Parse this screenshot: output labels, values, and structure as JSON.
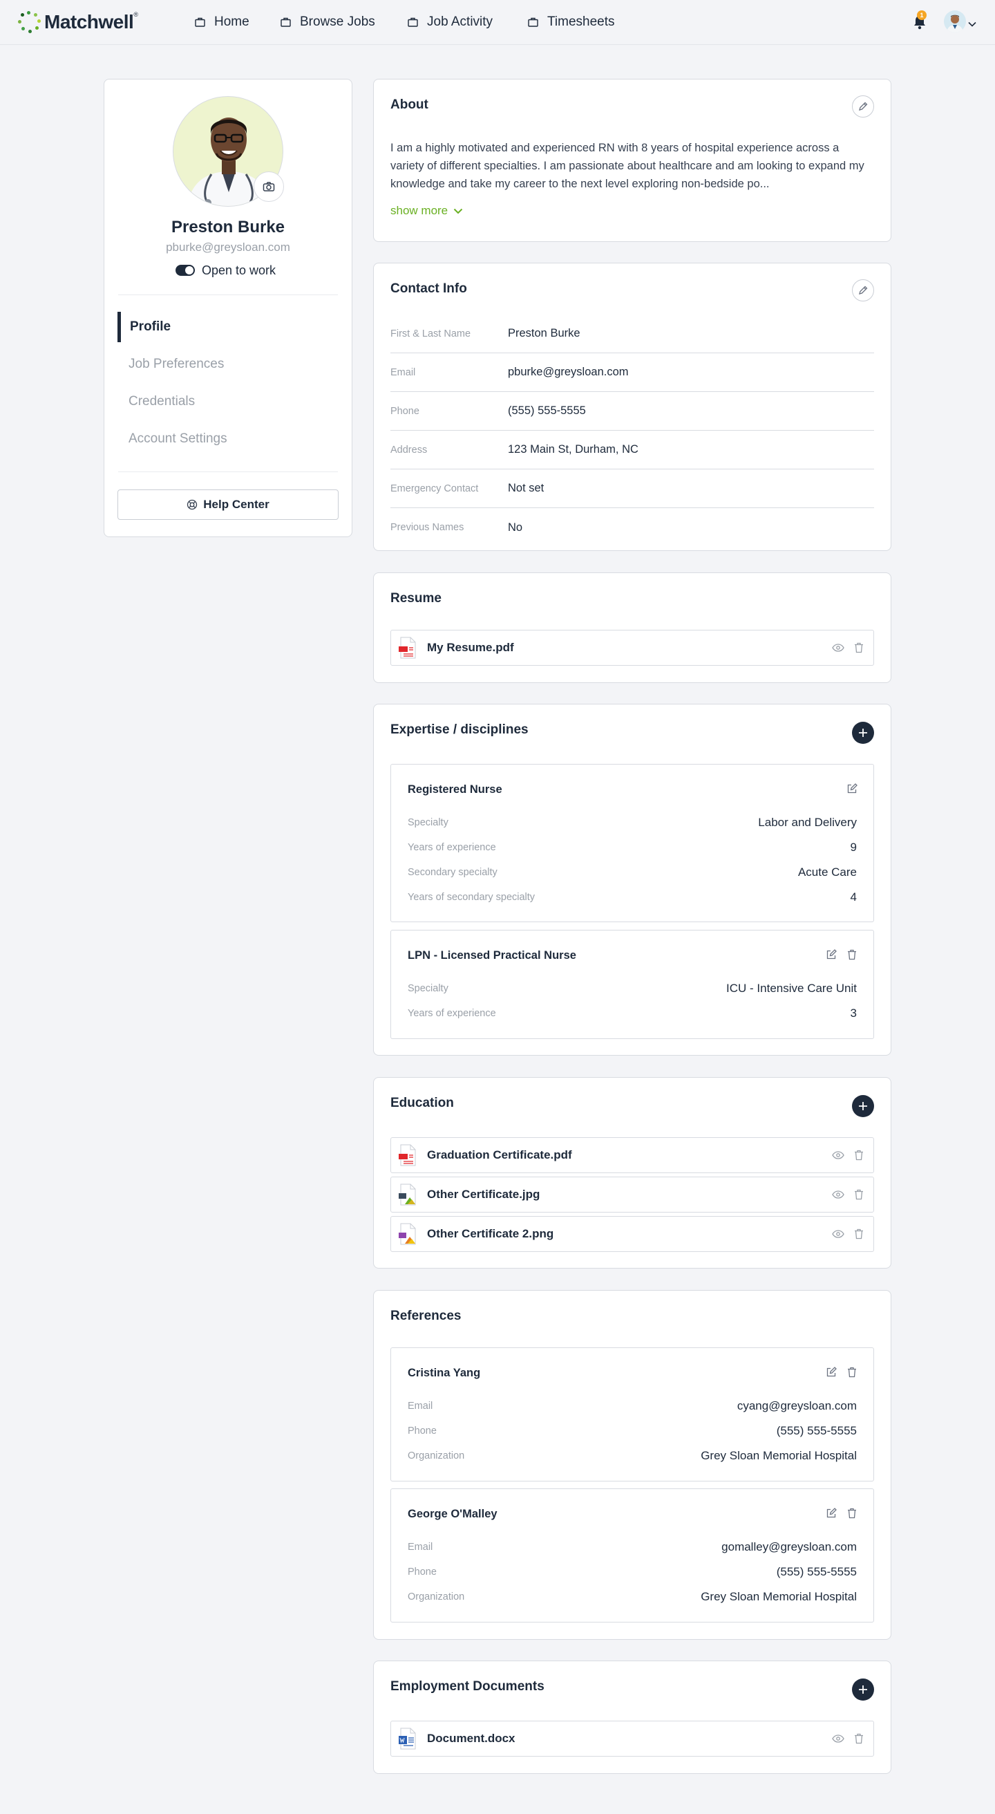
{
  "nav": {
    "brand": "Matchwell",
    "brand_mark": "®",
    "items": [
      {
        "label": "Home"
      },
      {
        "label": "Browse Jobs"
      },
      {
        "label": "Job Activity"
      },
      {
        "label": "Timesheets"
      }
    ],
    "notification_count": "1"
  },
  "profile": {
    "name": "Preston Burke",
    "email": "pburke@greysloan.com",
    "open_to_work_label": "Open to work",
    "menu": [
      {
        "label": "Profile",
        "active": true
      },
      {
        "label": "Job Preferences"
      },
      {
        "label": "Credentials"
      },
      {
        "label": "Account Settings"
      }
    ],
    "help_label": "Help Center"
  },
  "about": {
    "title": "About",
    "text": "I am a highly motivated and experienced RN with 8 years of hospital experience across a variety of different specialties. I am passionate about healthcare and am looking to expand my knowledge and take my career to the next level exploring non-bedside po...",
    "show_more": "show more"
  },
  "contact": {
    "title": "Contact Info",
    "rows": [
      {
        "label": "First & Last Name",
        "value": "Preston Burke"
      },
      {
        "label": "Email",
        "value": "pburke@greysloan.com"
      },
      {
        "label": "Phone",
        "value": "(555) 555-5555"
      },
      {
        "label": "Address",
        "value": "123 Main St, Durham, NC"
      },
      {
        "label": "Emergency Contact",
        "value": "Not set"
      },
      {
        "label": "Previous Names",
        "value": "No"
      }
    ]
  },
  "resume": {
    "title": "Resume",
    "files": [
      {
        "name": "My Resume.pdf",
        "type": "pdf"
      }
    ]
  },
  "expertise": {
    "title": "Expertise / disciplines",
    "items": [
      {
        "title": "Registered Nurse",
        "fields": [
          {
            "k": "Specialty",
            "v": "Labor and Delivery"
          },
          {
            "k": "Years of experience",
            "v": "9"
          },
          {
            "k": "Secondary specialty",
            "v": "Acute Care"
          },
          {
            "k": "Years of secondary specialty",
            "v": "4"
          }
        ]
      },
      {
        "title": "LPN - Licensed Practical Nurse",
        "fields": [
          {
            "k": "Specialty",
            "v": "ICU - Intensive Care Unit"
          },
          {
            "k": "Years of experience",
            "v": "3"
          }
        ]
      }
    ]
  },
  "education": {
    "title": "Education",
    "files": [
      {
        "name": "Graduation Certificate.pdf",
        "type": "pdf"
      },
      {
        "name": "Other Certificate.jpg",
        "type": "jpg"
      },
      {
        "name": "Other Certificate 2.png",
        "type": "png"
      }
    ]
  },
  "references": {
    "title": "References",
    "items": [
      {
        "name": "Cristina Yang",
        "fields": [
          {
            "k": "Email",
            "v": "cyang@greysloan.com"
          },
          {
            "k": "Phone",
            "v": "(555) 555-5555"
          },
          {
            "k": "Organization",
            "v": "Grey Sloan Memorial Hospital"
          }
        ]
      },
      {
        "name": "George O'Malley",
        "fields": [
          {
            "k": "Email",
            "v": "gomalley@greysloan.com"
          },
          {
            "k": "Phone",
            "v": "(555) 555-5555"
          },
          {
            "k": "Organization",
            "v": "Grey Sloan Memorial Hospital"
          }
        ]
      }
    ]
  },
  "employment": {
    "title": "Employment Documents",
    "files": [
      {
        "name": "Document.docx",
        "type": "docx"
      }
    ]
  },
  "colors": {
    "primary": "#1e2a3b",
    "accent_green": "#6ab023",
    "badge": "#f5a524",
    "pdf_red": "#e0262b"
  }
}
